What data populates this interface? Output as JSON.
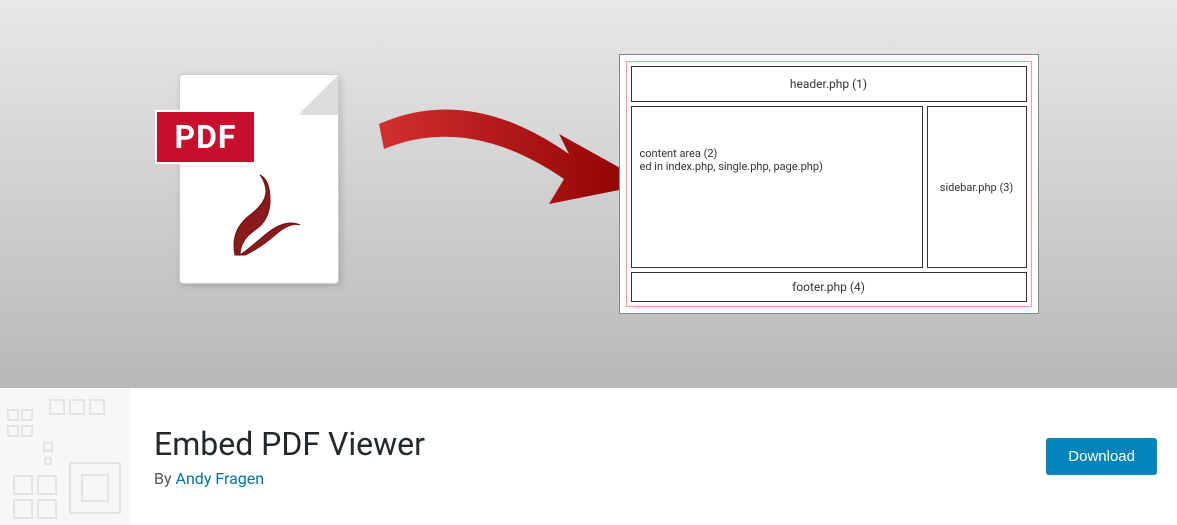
{
  "banner": {
    "pdf_badge": "PDF",
    "diagram": {
      "header": "header.php (1)",
      "content_line1": "content area (2)",
      "content_line2": "ed in index.php, single.php, page.php)",
      "sidebar": "sidebar.php (3)",
      "footer": "footer.php (4)"
    }
  },
  "info": {
    "title": "Embed PDF Viewer",
    "by_prefix": "By ",
    "author": "Andy Fragen",
    "download_label": "Download"
  }
}
